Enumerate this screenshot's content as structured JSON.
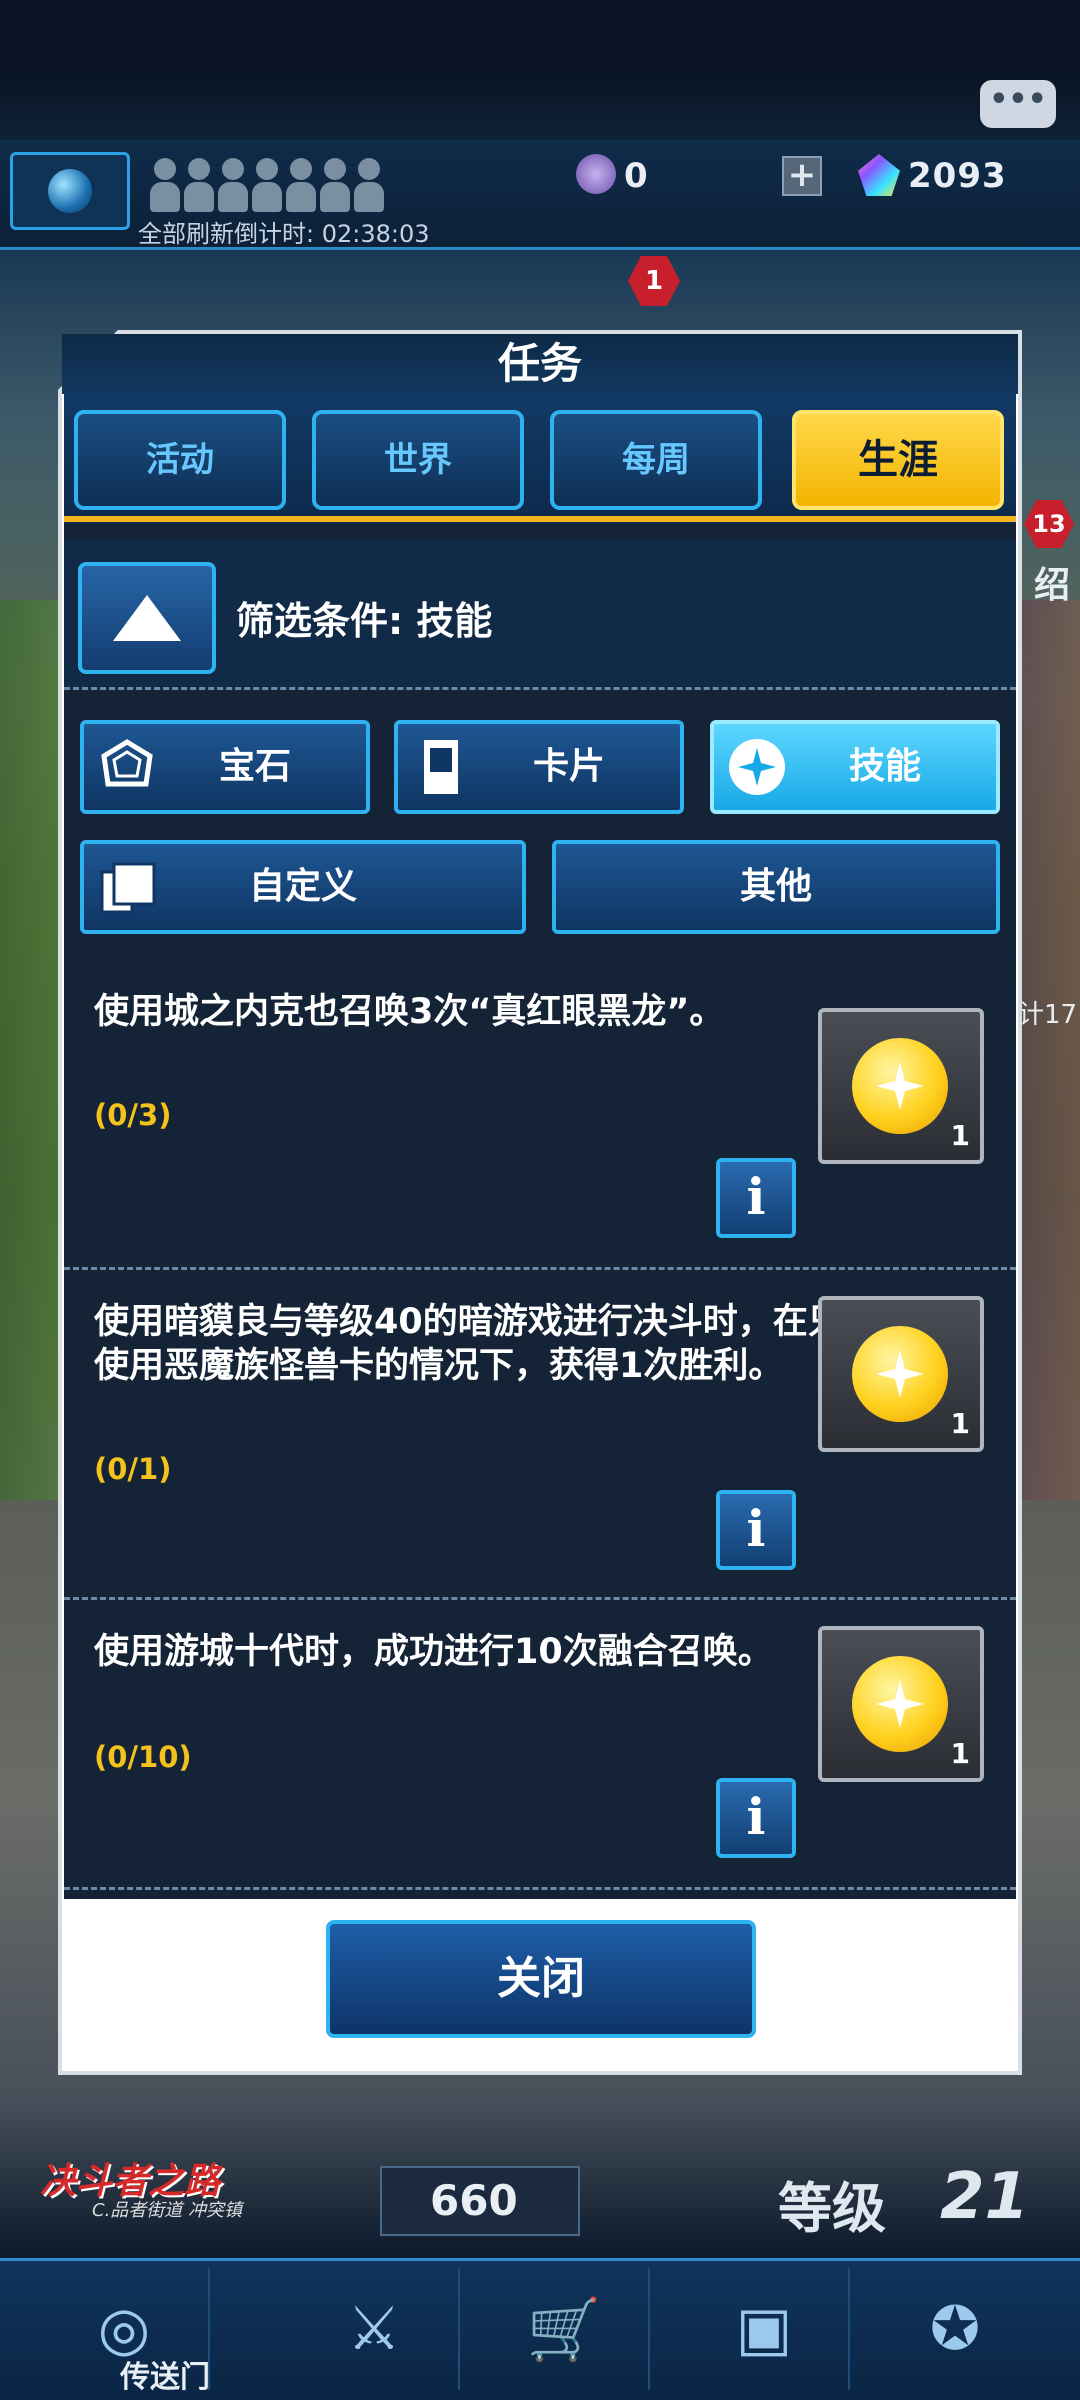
{
  "header": {
    "refresh_text": "全部刷新倒计时: 02:38:03",
    "gem_small_value": "0",
    "gem_value": "2093",
    "plus_label": "+",
    "chat_label": "•••",
    "badge_top": "1",
    "badge_right": "13",
    "side_char": "绍",
    "side_small": "计17"
  },
  "dialog": {
    "title": "任务",
    "tabs": [
      {
        "label": "活动",
        "active": false
      },
      {
        "label": "世界",
        "active": false
      },
      {
        "label": "每周",
        "active": false
      },
      {
        "label": "生涯",
        "active": true
      }
    ],
    "filter_label": "筛选条件: 技能",
    "filters": [
      {
        "label": "宝石",
        "icon": "gem-outline-icon",
        "selected": false
      },
      {
        "label": "卡片",
        "icon": "card-icon",
        "selected": false
      },
      {
        "label": "技能",
        "icon": "skill-star-icon",
        "selected": true
      },
      {
        "label": "自定义",
        "icon": "cards-stack-icon",
        "selected": false
      },
      {
        "label": "其他",
        "icon": "",
        "selected": false
      }
    ],
    "quests": [
      {
        "text": "使用城之内克也召唤3次“真红眼黑龙”。",
        "progress": "(0/3)",
        "reward_count": "1"
      },
      {
        "text": "使用暗貘良与等级40的暗游戏进行决斗时，在只使用恶魔族怪兽卡的情况下，获得1次胜利。",
        "progress": "(0/1)",
        "reward_count": "1"
      },
      {
        "text": "使用游城十代时，成功进行10次融合召唤。",
        "progress": "(0/10)",
        "reward_count": "1"
      }
    ],
    "info_label": "i",
    "close_label": "关闭"
  },
  "footer": {
    "road_logo": "决斗者之路",
    "road_sub": "C.品者街道 冲突镇",
    "points_value": "660",
    "level_label": "等级",
    "level_value": "21",
    "nav_label": "传送门",
    "nav_icons": [
      "portal-icon",
      "duel-swords-icon",
      "shop-cart-icon",
      "deck-cards-icon",
      "emblem-icon"
    ]
  },
  "colors": {
    "accent_blue": "#2fb3f0",
    "active_tab": "#f4b400",
    "progress": "#f4c21a",
    "panel": "#142436"
  }
}
